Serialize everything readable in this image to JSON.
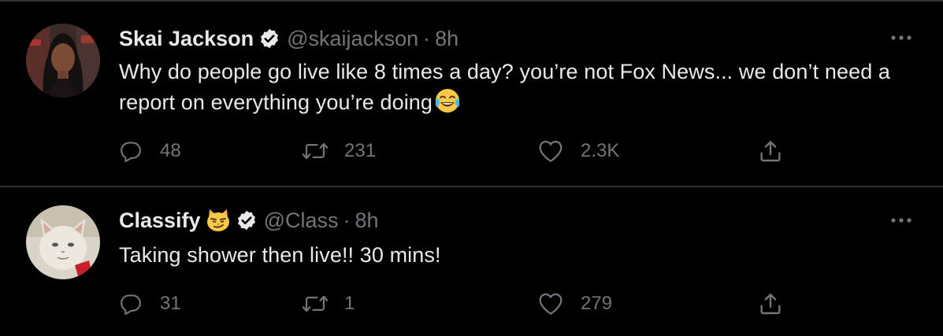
{
  "tweets": [
    {
      "display_name": "Skai Jackson",
      "handle": "@skaijackson",
      "separator": "·",
      "time": "8h",
      "text": "Why do people go live like 8 times a day? you’re not Fox News... we don’t need a report on everything you’re doing",
      "text_emoji": "face-with-tears-of-joy",
      "verified": true,
      "replies": "48",
      "retweets": "231",
      "likes": "2.3K"
    },
    {
      "display_name": "Classify",
      "name_emoji": "smirking-cat-face",
      "handle": "@Class",
      "separator": "·",
      "time": "8h",
      "text": "Taking shower then live!! 30 mins!",
      "verified": true,
      "replies": "31",
      "retweets": "1",
      "likes": "279"
    }
  ],
  "colors": {
    "background": "#000000",
    "text": "#e7e9ea",
    "secondary": "#71767b",
    "divider": "#2f3336"
  }
}
